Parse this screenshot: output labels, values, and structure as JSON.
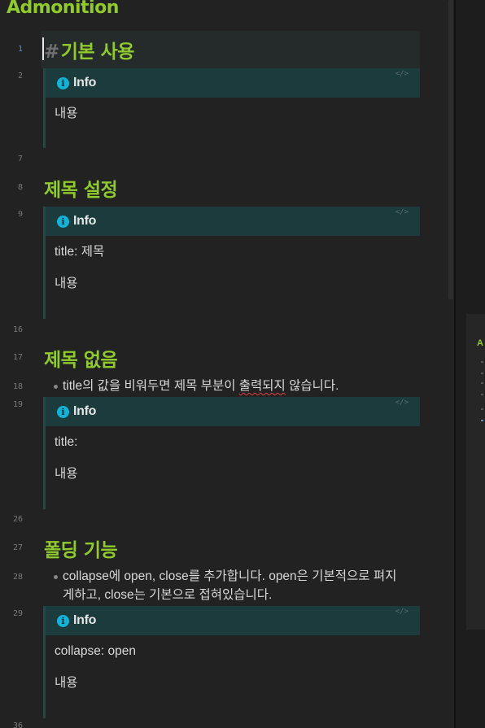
{
  "document": {
    "title": "Admonition"
  },
  "gutter": [
    "1",
    "2",
    "7",
    "8",
    "9",
    "16",
    "17",
    "18",
    "19",
    "26",
    "27",
    "28",
    "29",
    "36"
  ],
  "sections": [
    {
      "heading_mark": "#",
      "heading": "기본 사용"
    },
    {
      "heading": "제목 설정"
    },
    {
      "heading": "제목 없음"
    },
    {
      "heading": "폴딩 기능"
    }
  ],
  "admonitions": [
    {
      "title": "Info",
      "code_icon": "</>",
      "lines": [
        "내용"
      ]
    },
    {
      "title": "Info",
      "code_icon": "</>",
      "lines": [
        "title: 제목",
        "내용"
      ]
    },
    {
      "title": "Info",
      "code_icon": "</>",
      "lines": [
        "title:",
        "내용"
      ]
    },
    {
      "title": "Info",
      "code_icon": "</>",
      "lines": [
        "collapse: open",
        "내용"
      ]
    }
  ],
  "bullets": {
    "no_title": {
      "before": "title의 값을 비워두면 제목 부분이 ",
      "squiggle": "출력되지",
      "after": " 않습니다."
    },
    "folding": {
      "line1": "collapse에 open, close를 추가합니다. open은 기본적으로 펴지",
      "line2": "게하고, close는 기본으로 접혀있습니다."
    }
  },
  "minimap": {
    "title": "A"
  },
  "colors": {
    "heading": "#8fcb2c",
    "info_icon": "#13b3d8",
    "admonition_header": "#1b3b3d",
    "active_line_number": "#4a8fd8"
  }
}
